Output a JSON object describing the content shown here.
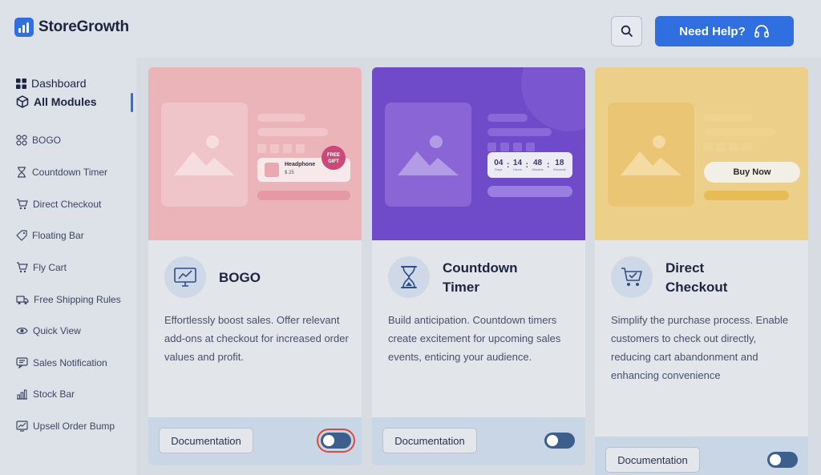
{
  "brand": {
    "name": "StoreGrowth"
  },
  "header": {
    "help_label": "Need Help?"
  },
  "sidebar": {
    "dashboard": "Dashboard",
    "all_modules": "All Modules",
    "items": [
      {
        "label": "BOGO",
        "icon": "bogo-icon"
      },
      {
        "label": "Countdown Timer",
        "icon": "hourglass-icon"
      },
      {
        "label": "Direct Checkout",
        "icon": "cart-icon"
      },
      {
        "label": "Floating Bar",
        "icon": "tag-icon"
      },
      {
        "label": "Fly Cart",
        "icon": "cart-icon"
      },
      {
        "label": "Free Shipping Rules",
        "icon": "truck-icon"
      },
      {
        "label": "Quick View",
        "icon": "eye-icon"
      },
      {
        "label": "Sales Notification",
        "icon": "notification-icon"
      },
      {
        "label": "Stock Bar",
        "icon": "bar-chart-icon"
      },
      {
        "label": "Upsell Order Bump",
        "icon": "chart-up-icon"
      }
    ]
  },
  "cards": [
    {
      "title_lines": [
        "BOGO"
      ],
      "description": "Effortlessly boost sales. Offer relevant add-ons at checkout for increased order values and profit.",
      "doc_label": "Documentation",
      "banner": {
        "product_name": "Headphone",
        "product_price": "$ 25",
        "badge_line1": "FREE",
        "badge_line2": "GIFT"
      },
      "accent": "#eab4b9"
    },
    {
      "title_lines": [
        "Countdown",
        "Timer"
      ],
      "description": "Build anticipation. Countdown timers create excitement for upcoming sales events, enticing your audience.",
      "doc_label": "Documentation",
      "banner": {
        "timer": [
          {
            "value": "04",
            "unit": "Days"
          },
          {
            "value": "14",
            "unit": "Hours"
          },
          {
            "value": "48",
            "unit": "Minutes"
          },
          {
            "value": "18",
            "unit": "Seconds"
          }
        ]
      },
      "accent": "#6f4ac9"
    },
    {
      "title_lines": [
        "Direct",
        "Checkout"
      ],
      "description": "Simplify the purchase process. Enable customers to check out directly, reducing cart abandonment and enhancing convenience",
      "doc_label": "Documentation",
      "banner": {
        "buy_label": "Buy Now"
      },
      "accent": "#ecd08a"
    }
  ],
  "colors": {
    "primary": "#2f6fe0",
    "toggle": "#3d5f8e",
    "highlight": "#e0483e"
  }
}
